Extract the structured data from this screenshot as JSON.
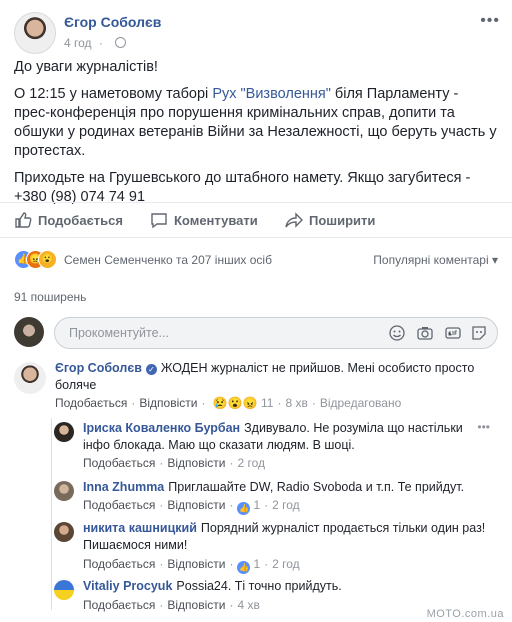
{
  "post": {
    "author": "Єгор Соболєв",
    "time": "4 год",
    "p1": "До уваги журналістів!",
    "p2_before": "О 12:15 у наметовому таборі ",
    "p2_link": "Рух \"Визволення\"",
    "p2_after": " біля Парламенту - прес-конференція про порушення кримінальних справ, допити та обшуки у родинах ветеранів Війни за Незалежності, що беруть участь у протестах.",
    "p3": "Приходьте на Грушевського до штабного намету. Якщо загубитеся - +380 (98) 074 74 91"
  },
  "actions": {
    "like": "Подобається",
    "comment": "Коментувати",
    "share": "Поширити"
  },
  "reactions": {
    "text": "Семен Семенченко та 207 інших осіб",
    "sort": "Популярні коментарі"
  },
  "shares": "91 поширень",
  "composer": {
    "placeholder": "Прокоментуйте..."
  },
  "comments": [
    {
      "name": "Єгор Соболєв",
      "text": "ЖОДЕН журналіст не прийшов. Мені особисто просто боляче",
      "like": "Подобається",
      "reply": "Відповісти",
      "reacts": "11",
      "time": "8 хв",
      "edited": "Відредаговано"
    },
    {
      "name": "Іриска Коваленко Бурбан",
      "text": "Здивувало. Не розуміла що настільки інфо блокада. Маю що сказати людям. В шоці.",
      "like": "Подобається",
      "reply": "Відповісти",
      "time": "2 год"
    },
    {
      "name": "Inna Zhumma",
      "text": "Приглашайте DW, Radio Svoboda и т.п. Те прийдут.",
      "like": "Подобається",
      "reply": "Відповісти",
      "reacts": "1",
      "time": "2 год"
    },
    {
      "name": "никита кашницкий",
      "text": "Порядний журналіст продається тільки один раз! Пишаємося ними!",
      "like": "Подобається",
      "reply": "Відповісти",
      "reacts": "1",
      "time": "2 год"
    },
    {
      "name": "Vitaliy Procyuk",
      "text": "Possia24. Ті точно прийдуть.",
      "like": "Подобається",
      "reply": "Відповісти",
      "time": "4 хв"
    }
  ],
  "watermark": "MOTO.com.ua"
}
